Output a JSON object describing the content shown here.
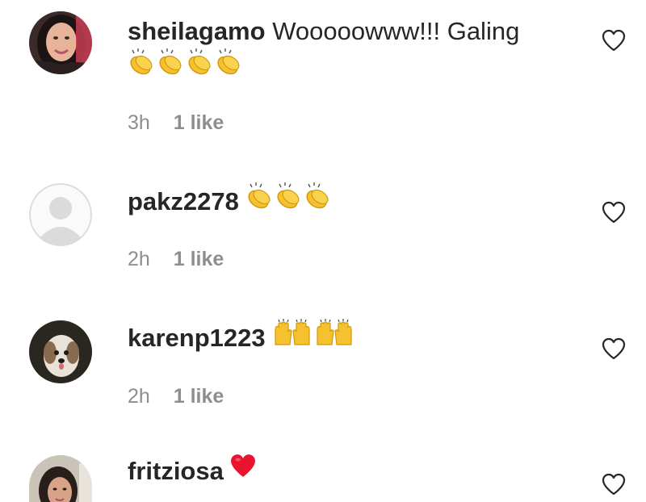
{
  "comments": [
    {
      "username": "sheilagamo",
      "text": "Wooooowww!!! Galing",
      "emojis": [
        "clapping-hands",
        "clapping-hands",
        "clapping-hands",
        "clapping-hands"
      ],
      "time": "3h",
      "likes": "1 like",
      "avatar": "photo-woman"
    },
    {
      "username": "pakz2278",
      "text": "",
      "emojis": [
        "clapping-hands",
        "clapping-hands",
        "clapping-hands"
      ],
      "time": "2h",
      "likes": "1 like",
      "avatar": "default-placeholder"
    },
    {
      "username": "karenp1223",
      "text": "",
      "emojis": [
        "raising-hands",
        "raising-hands"
      ],
      "time": "2h",
      "likes": "1 like",
      "avatar": "photo-dog"
    },
    {
      "username": "fritziosa",
      "text": "",
      "emojis": [
        "red-heart"
      ],
      "avatar": "photo-woman-2"
    }
  ],
  "colors": {
    "text": "#262626",
    "secondary": "#8e8e8e",
    "emoji_yellow": "#f6c12f",
    "heart_red": "#e8132c",
    "placeholder": "#dbdbdb"
  }
}
